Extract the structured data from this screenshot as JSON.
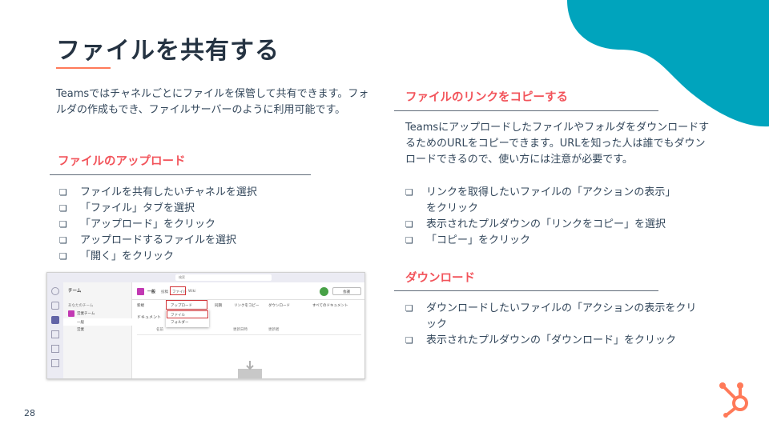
{
  "title": "ファイルを共有する",
  "intro": "Teamsではチャネルごとにファイルを保管して共有できます。フォルダの作成もでき、ファイルサーバーのように利用可能です。",
  "upload": {
    "heading": "ファイルのアップロード",
    "items": [
      "ファイルを共有したいチャネルを選択",
      "「ファイル」タブを選択",
      "「アップロード」をクリック",
      "アップロードするファイルを選択",
      "「開く」をクリック"
    ]
  },
  "copy_link": {
    "heading": "ファイルのリンクをコピーする",
    "body": "TeamsにアップロードしたファイルやフォルダをダウンロードするためのURLをコピーできます。URLを知った人は誰でもダウンロードできるので、使い方には注意が必要です。",
    "items": [
      "リンクを取得したいファイルの「アクションの表示」をクリック",
      "表示されたプルダウンの「リンクをコピー」を選択",
      "「コピー」をクリック"
    ]
  },
  "download": {
    "heading": "ダウンロード",
    "items": [
      "ダウンロードしたいファイルの「アクションの表示をクリック",
      "表示されたプルダウンの「ダウンロード」をクリック"
    ]
  },
  "bullet_glyph": "❏",
  "page_number": "28",
  "colors": {
    "title": "#253342",
    "accent_orange": "#ff7a59",
    "heading_red": "#f2545b",
    "blob_teal": "#00a4bd",
    "text": "#33475b"
  },
  "screenshot": {
    "search": "検索",
    "pane_title": "チーム",
    "team_label": "あなたのチーム",
    "team_name": "営業チーム",
    "channel_general": "一般",
    "channel_other": "営業",
    "channel_header": "一般",
    "tab_posts": "投稿",
    "tab_files": "ファイル",
    "tab_wiki": "Wiki",
    "toolbar_new": "新規",
    "toolbar_upload": "アップロード",
    "toolbar_sync": "同期",
    "toolbar_copylink": "リンクをコピー",
    "toolbar_download": "ダウンロード",
    "toolbar_all_docs": "すべてのドキュメント",
    "breadcrumb": "ドキュメント",
    "col_name": "名前",
    "col_modified": "更新日時",
    "col_modified_by": "更新者",
    "menu_files": "ファイル",
    "menu_folder": "フォルダー",
    "meeting_button": "会議"
  }
}
